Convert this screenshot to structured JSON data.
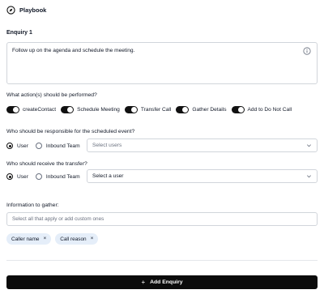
{
  "header": {
    "title": "Playbook",
    "icon": "playbook-compass-icon"
  },
  "enquiry": {
    "label": "Enquiry 1",
    "text": "Follow up on the agenda and schedule the meeting.",
    "info_icon": "info-icon"
  },
  "actions": {
    "label": "What action(s) should be performed?",
    "items": [
      {
        "label": "createContact",
        "on": true
      },
      {
        "label": "Schedule Meeting",
        "on": true
      },
      {
        "label": "Transfer Call",
        "on": true
      },
      {
        "label": "Gather Details",
        "on": true
      },
      {
        "label": "Add to Do Not Call",
        "on": true
      }
    ]
  },
  "scheduled": {
    "label": "Who should be responsible for the scheduled event?",
    "options": [
      "User",
      "Inbound Team"
    ],
    "selected": "User",
    "select_placeholder": "Select users"
  },
  "transfer": {
    "label": "Who should receive the transfer?",
    "options": [
      "User",
      "Inbound Team"
    ],
    "selected": "User",
    "select_value": "Select a user"
  },
  "gather": {
    "label": "Information to gather:",
    "placeholder": "Select all that apply or add custom ones",
    "chips": [
      "Caller name",
      "Call reason"
    ],
    "chip_remove": "×"
  },
  "add_button": {
    "label": "Add Enquiry",
    "icon": "+"
  },
  "colors": {
    "primary": "#0b0b0b",
    "chip_bg": "#e5eef9",
    "border": "#d1d5db"
  }
}
